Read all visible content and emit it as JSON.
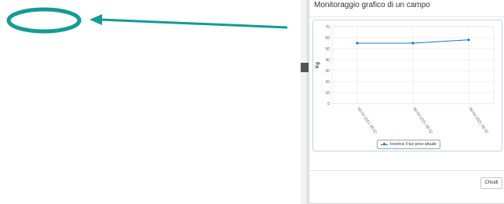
{
  "modal": {
    "title": "Monitoraggio grafico di un campo",
    "close_label": "Chiudi"
  },
  "annotation": {
    "color": "#129c94"
  },
  "chart_data": {
    "type": "line",
    "ylabel": "Kg",
    "ylim": [
      0,
      70
    ],
    "yticks": [
      0,
      10,
      20,
      30,
      40,
      50,
      60,
      70
    ],
    "x": [
      "06-04-2021 09:32",
      "06-04-2021 09:32",
      "06-04-2021 09:32"
    ],
    "series": [
      {
        "name": "Inserisci il tuo peso attuale",
        "values": [
          55,
          55,
          58
        ],
        "color": "#1f77b4"
      }
    ],
    "grid": true,
    "legend": "bottom-center"
  }
}
